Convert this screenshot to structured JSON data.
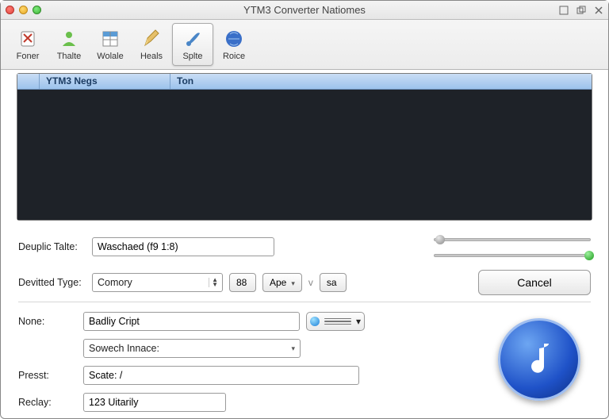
{
  "window": {
    "title": "YTM3 Converter Natiomes"
  },
  "toolbar": {
    "items": [
      {
        "label": "Foner"
      },
      {
        "label": "Thalte"
      },
      {
        "label": "Wolale"
      },
      {
        "label": "Heals"
      },
      {
        "label": "Splte"
      },
      {
        "label": "Roice"
      }
    ],
    "active_index": 4
  },
  "table": {
    "columns": [
      "",
      "YTM3 Negs",
      "Ton"
    ]
  },
  "form": {
    "deuplic_label": "Deuplic Talte:",
    "deuplic_value": "Waschaed (f9 1:8)",
    "devitted_label": "Devitted Tyge:",
    "devitted_value": "Comory",
    "btn1": "88",
    "btn2": "Ape",
    "sep": "v",
    "btn3": "sa",
    "cancel": "Cancel"
  },
  "lower": {
    "none_label": "None:",
    "none_value": "Badliy Cript",
    "sowech_value": "Sowech Innace:",
    "presst_label": "Presst:",
    "presst_value": "Scate: /",
    "reclay_label": "Reclay:",
    "reclay_value": "123 Uitarily"
  }
}
